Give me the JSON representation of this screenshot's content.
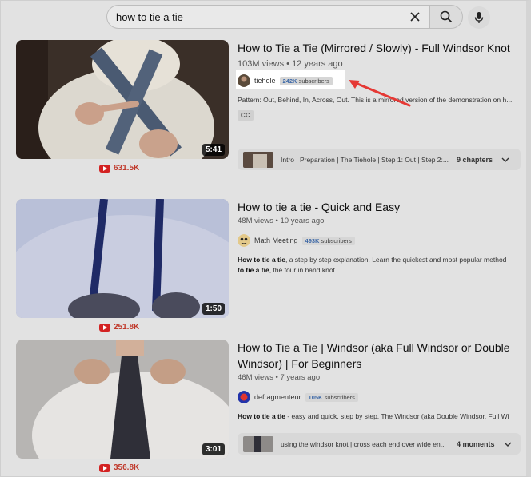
{
  "search": {
    "query": "how to tie a tie"
  },
  "results": [
    {
      "title": "How to Tie a Tie (Mirrored / Slowly) - Full Windsor Knot",
      "views": "103M views",
      "age": "12 years ago",
      "channel": "tiehole",
      "subscribers": "242K",
      "subscribers_suffix": "subscribers",
      "description": "Pattern: Out, Behind, In, Across, Out. This is a mirrored version of the demonstration on h...",
      "badge": "CC",
      "duration": "5:41",
      "yt_count": "631.5K",
      "chapters_text": "Intro | Preparation | The Tiehole | Step 1: Out | Step 2:...",
      "chapters_count": "9 chapters"
    },
    {
      "title": "How to tie a tie - Quick and Easy",
      "views": "48M views",
      "age": "10 years ago",
      "channel": "Math Meeting",
      "subscribers": "493K",
      "subscribers_suffix": "subscribers",
      "description_bold": "How to tie a tie",
      "description": ", a step by step explanation. Learn the quickest and most popular method",
      "description_line2_bold": "to tie a tie",
      "description_line2": ", the four in hand knot.",
      "duration": "1:50",
      "yt_count": "251.8K"
    },
    {
      "title": "How to Tie a Tie | Windsor (aka Full Windsor or Double Windsor) | For Beginners",
      "views": "46M views",
      "age": "7 years ago",
      "channel": "defragmenteur",
      "subscribers": "105K",
      "subscribers_suffix": "subscribers",
      "description_bold": "How to tie a tie",
      "description": " - easy and quick, step by step. The Windsor (aka Double Windsor, Full Wi",
      "duration": "3:01",
      "yt_count": "356.8K",
      "chapters_text": "using the windsor knot | cross each end over wide en...",
      "chapters_count": "4 moments"
    }
  ],
  "colors": {
    "accent_red": "#e53935",
    "subs_blue": "#3f6aa8",
    "yt_red": "#d32222"
  }
}
